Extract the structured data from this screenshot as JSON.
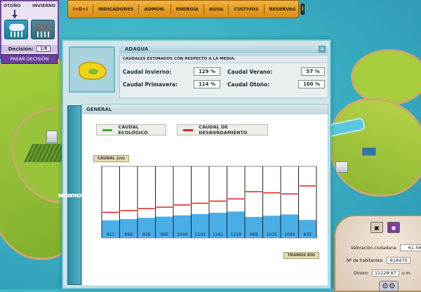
{
  "season": {
    "left_label": "OTOÑO",
    "right_label": "INVIERNO",
    "decision_label": "Decisión:",
    "decision_value": "1/8",
    "pasar_label": "PASAR DECISIÓN"
  },
  "menu": {
    "items": [
      "I+D+i",
      "INDICADORES",
      "ADMÓN.",
      "ENERGÍA",
      "AGUA",
      "CULTIVOS",
      "RESERVAS"
    ],
    "info_icon": "info-icon"
  },
  "window": {
    "title": "ADAGUA",
    "caudales_header": "CAUDALES ESTIMADOS CON RESPECTO A LA MEDIA:",
    "invierno_label": "Caudal Invierno:",
    "invierno_value": "129 %",
    "verano_label": "Caudal Verano:",
    "verano_value": "57 %",
    "primavera_label": "Caudal Primavera:",
    "primavera_value": "114 %",
    "otono_label": "Caudal Otoño:",
    "otono_value": "100 %",
    "side_tab_line1": "ENCAUZAR",
    "side_tab_line2": "TRASVASAR",
    "general_title": "GENERAL",
    "legend_eco": "CAUDAL ECOLÓGICO",
    "legend_desb": "CAUDAL DE DESBORDAMIENTO",
    "caudal_label": "CAUDAL (l/s)",
    "tramos_label": "TRAMOS RÍO",
    "colors": {
      "eco": "#3cae2e",
      "desb": "#e02020",
      "bar": "#4aaee6"
    }
  },
  "chart_data": {
    "type": "bar",
    "values": [
      811,
      869,
      928,
      985,
      1044,
      1102,
      1161,
      1219,
      968,
      1025,
      1084,
      832
    ],
    "ylabel": "CAUDAL (l/s)",
    "xlabel": "TRAMOS RÍO",
    "desbordamiento": [
      1180,
      1260,
      1350,
      1420,
      1520,
      1600,
      1700,
      1800,
      2130,
      2080,
      2030,
      2400
    ],
    "ecologico": [],
    "ylim": [
      0,
      3300
    ]
  },
  "stats": {
    "valoracion_label": "Valoración ciudadana:",
    "valoracion_value": "61.56",
    "habitantes_label": "Nº de habitantes:",
    "habitantes_value": "618470",
    "dinero_label": "Dinero:",
    "dinero_value": "12128.87",
    "dinero_unit": "u.m."
  }
}
